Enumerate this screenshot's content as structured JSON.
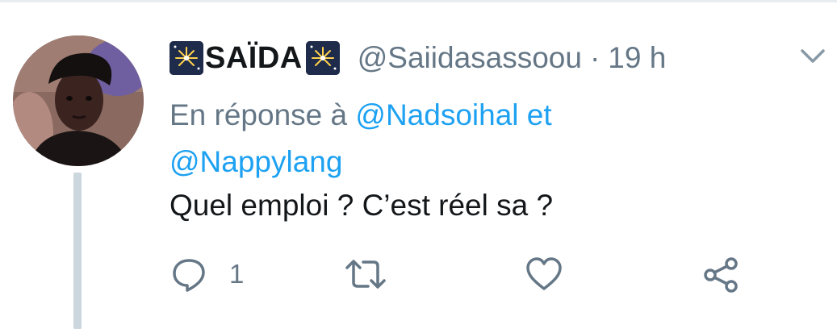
{
  "tweet": {
    "display_name": "SAÏDA",
    "handle": "@Saiidasassoou",
    "separator": "·",
    "time": "19 h",
    "reply_to": {
      "prefix": "En réponse à",
      "mention_1": "@Nadsoihal",
      "conjunction": "et",
      "mention_2": "@Nappylang"
    },
    "text": "Quel emploi ? C’est réel sa ?"
  },
  "actions": {
    "reply_count": "1"
  },
  "colors": {
    "link": "#1da1f2",
    "secondary_text": "#657786",
    "primary_text": "#14171a",
    "thread_line": "#ccd6dd"
  },
  "icons": [
    "fireworks-emoji-icon",
    "chevron-down-icon",
    "reply-icon",
    "retweet-icon",
    "like-icon",
    "share-icon"
  ]
}
